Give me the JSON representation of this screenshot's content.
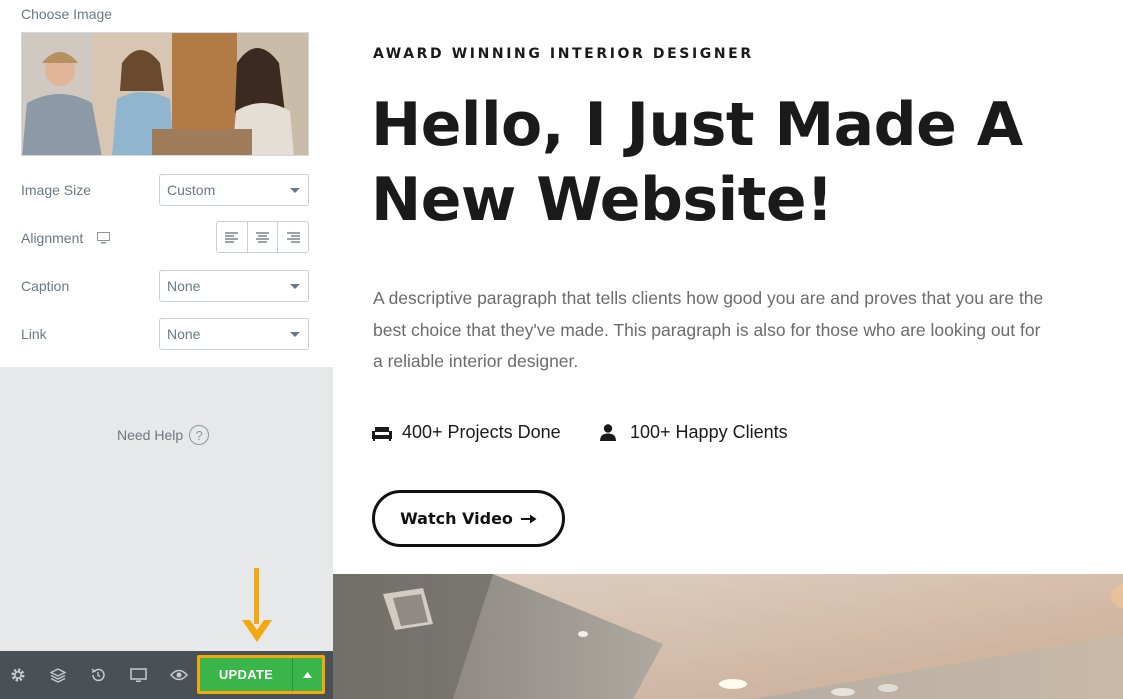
{
  "panel": {
    "choose_image_label": "Choose Image",
    "fields": {
      "image_size": {
        "label": "Image Size",
        "value": "Custom"
      },
      "alignment": {
        "label": "Alignment",
        "options": [
          "align-left",
          "align-center",
          "align-right"
        ]
      },
      "caption": {
        "label": "Caption",
        "value": "None"
      },
      "link": {
        "label": "Link",
        "value": "None"
      }
    },
    "need_help": "Need Help",
    "help_glyph": "?"
  },
  "footer": {
    "icons": [
      "settings-icon",
      "layers-icon",
      "history-icon",
      "responsive-icon",
      "preview-icon"
    ],
    "update_label": "UPDATE",
    "accent_color": "#39b54a",
    "highlight_color": "#f5a70f"
  },
  "content": {
    "eyebrow": "AWARD WINNING INTERIOR DESIGNER",
    "headline_line1": "Hello, I Just Made A",
    "headline_line2": "New Website!",
    "paragraph": "A descriptive paragraph that tells clients how good you are and proves that you are the best choice that they've made. This paragraph is also for those who are looking out for a reliable interior designer.",
    "stats": [
      {
        "icon": "sofa-icon",
        "text": "400+ Projects Done"
      },
      {
        "icon": "user-icon",
        "text": "100+ Happy Clients"
      }
    ],
    "watch_video_label": "Watch Video",
    "arrow_glyph": "➞"
  }
}
